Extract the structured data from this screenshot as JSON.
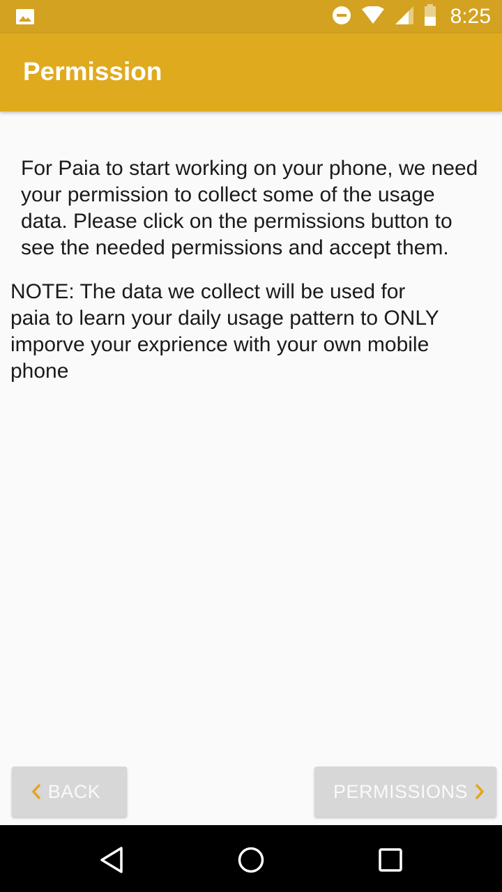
{
  "status_bar": {
    "time": "8:25",
    "icons": [
      "gallery-icon",
      "do-not-disturb-icon",
      "wifi-icon",
      "signal-icon",
      "battery-icon"
    ]
  },
  "app_bar": {
    "title": "Permission"
  },
  "content": {
    "body": "For Paia to start working on your phone, we need\nyour permission to collect some of the usage\ndata. Please click on the permissions button to\nsee the needed permissions and accept them.",
    "note": " NOTE: The data we collect will be used for\npaia to learn your daily usage pattern to ONLY\nimporve your exprience with your own mobile\nphone"
  },
  "buttons": {
    "back_label": "BACK",
    "permissions_label": "PERMISSIONS"
  },
  "colors": {
    "status_bar": "#d3a220",
    "app_bar": "#dfaa1e",
    "accent": "#e2a51d",
    "button_bg": "#d7d7d7"
  },
  "nav_bar": {
    "icons": [
      "back-triangle-icon",
      "home-circle-icon",
      "recents-square-icon"
    ]
  }
}
